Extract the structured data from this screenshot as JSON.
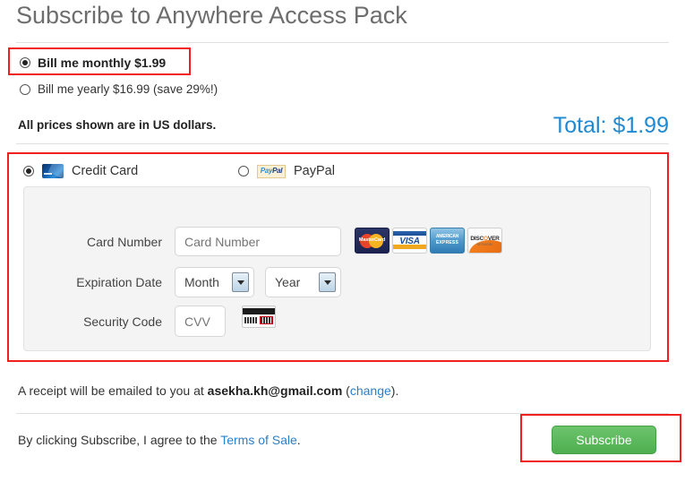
{
  "page": {
    "title": "Subscribe to Anywhere Access Pack"
  },
  "plans": {
    "options": [
      {
        "label": "Bill me monthly $1.99",
        "selected": true
      },
      {
        "label": "Bill me yearly $16.99 (save 29%!)",
        "selected": false
      }
    ]
  },
  "pricing": {
    "note": "All prices shown are in US dollars.",
    "total_label": "Total: $1.99",
    "total_color": "#1f8ad4"
  },
  "payment": {
    "methods": [
      {
        "label": "Credit Card",
        "selected": true,
        "icon": "credit-card-icon"
      },
      {
        "label": "PayPal",
        "selected": false,
        "icon": "paypal-icon"
      }
    ],
    "paypal_badge": {
      "pay": "Pay",
      "pal": "Pal"
    },
    "fields": {
      "card_number": {
        "label": "Card Number",
        "placeholder": "Card Number",
        "value": ""
      },
      "expiration": {
        "label": "Expiration Date",
        "month": {
          "selected": "Month"
        },
        "year": {
          "selected": "Year"
        }
      },
      "security_code": {
        "label": "Security Code",
        "placeholder": "CVV",
        "value": ""
      }
    },
    "accepted_brands": [
      {
        "name": "mastercard-logo",
        "text": "MasterCard"
      },
      {
        "name": "visa-logo",
        "text": "VISA"
      },
      {
        "name": "amex-logo",
        "line1": "AMERICAN",
        "line2": "EXPRESS"
      },
      {
        "name": "discover-logo",
        "text_a": "DISC",
        "text_o": "O",
        "text_b": "VER",
        "sub": "NETWORK"
      }
    ]
  },
  "receipt": {
    "prefix": "A receipt will be emailed to you at ",
    "email": "asekha.kh@gmail.com",
    "paren_open": " (",
    "change_link": "change",
    "paren_close": ")."
  },
  "terms": {
    "prefix": "By clicking Subscribe, I agree to the ",
    "link": "Terms of Sale",
    "suffix": "."
  },
  "actions": {
    "subscribe_label": "Subscribe",
    "subscribe_color": "#5cb85c"
  },
  "annotations": {
    "color": "#f02020",
    "boxes": [
      "monthly-plan-highlight",
      "payment-section-highlight",
      "subscribe-button-highlight"
    ]
  }
}
